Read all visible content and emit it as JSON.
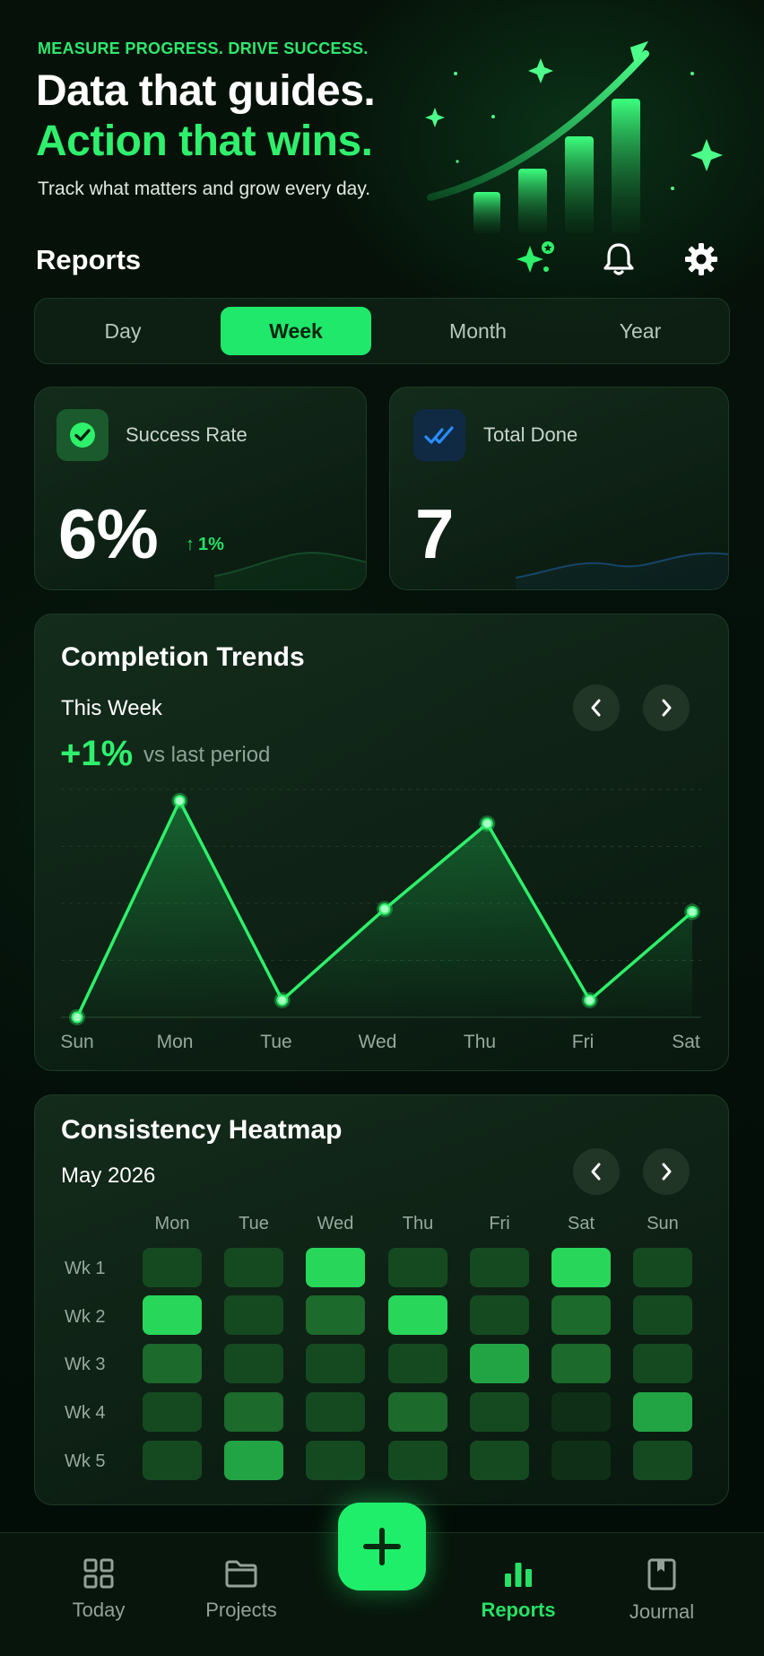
{
  "hero": {
    "eyebrow": "MEASURE PROGRESS. DRIVE SUCCESS.",
    "headline_line1": "Data that guides.",
    "headline_line2": "Action that wins.",
    "subtitle": "Track what matters and grow every day."
  },
  "header": {
    "title": "Reports",
    "icons": [
      "sparkles-icon",
      "bell-icon",
      "gear-icon"
    ]
  },
  "period_tabs": {
    "items": [
      "Day",
      "Week",
      "Month",
      "Year"
    ],
    "selected": "Week"
  },
  "stats": {
    "success_rate": {
      "label": "Success Rate",
      "value": "6%",
      "delta": "1%",
      "icon": "check-circle-icon"
    },
    "total_done": {
      "label": "Total Done",
      "value": "7",
      "icon": "double-check-icon"
    }
  },
  "completion_trends": {
    "title": "Completion Trends",
    "period": "This Week",
    "delta": "+1%",
    "delta_caption": "vs last period"
  },
  "chart_data": {
    "type": "line",
    "categories": [
      "Sun",
      "Mon",
      "Tue",
      "Wed",
      "Thu",
      "Fri",
      "Sat"
    ],
    "values": [
      0,
      3.8,
      0.3,
      1.9,
      3.4,
      0.3,
      1.85
    ],
    "ylim": [
      0,
      4
    ],
    "grid": true,
    "colors": {
      "line": "#2ef06a",
      "point": "#a8ffc4"
    }
  },
  "heatmap": {
    "title": "Consistency Heatmap",
    "month": "May 2026",
    "columns": [
      "Mon",
      "Tue",
      "Wed",
      "Thu",
      "Fri",
      "Sat",
      "Sun"
    ],
    "rows": [
      "Wk 1",
      "Wk 2",
      "Wk 3",
      "Wk 4",
      "Wk 5"
    ],
    "levels": [
      [
        1,
        1,
        4,
        1,
        1,
        4,
        1
      ],
      [
        4,
        1,
        2,
        4,
        1,
        2,
        1
      ],
      [
        2,
        1,
        1,
        1,
        3,
        2,
        1
      ],
      [
        1,
        2,
        1,
        2,
        1,
        0,
        3
      ],
      [
        1,
        3,
        1,
        1,
        1,
        0,
        1
      ]
    ],
    "level_colors": [
      "#0f3016",
      "#154a20",
      "#1c6a2c",
      "#22a445",
      "#28d65a"
    ]
  },
  "bottom_nav": {
    "items": [
      {
        "label": "Today",
        "icon": "grid-icon"
      },
      {
        "label": "Projects",
        "icon": "folder-icon"
      },
      {
        "label": "Reports",
        "icon": "bar-chart-icon"
      },
      {
        "label": "Journal",
        "icon": "journal-icon"
      }
    ],
    "active": "Reports",
    "fab_icon": "plus-icon"
  },
  "colors": {
    "accent": "#1fe86a",
    "background": "#051008",
    "blue_accent": "#2a8cff"
  }
}
